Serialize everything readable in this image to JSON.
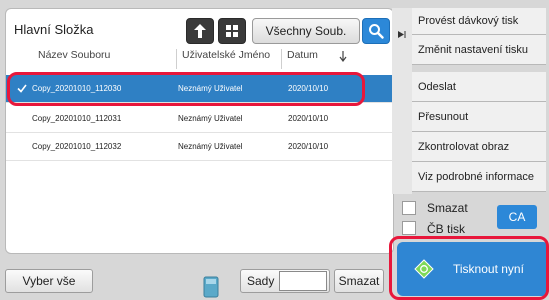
{
  "file_panel": {
    "folder_title": "Hlavní Složka",
    "filter_label": "Všechny Soub.",
    "columns": {
      "name": "Název Souboru",
      "user": "Uživatelské Jméno",
      "date": "Datum"
    },
    "rows": [
      {
        "name": "Copy_20201010_112030",
        "user": "Neznámý Uživatel",
        "date": "2020/10/10",
        "selected": true
      },
      {
        "name": "Copy_20201010_112031",
        "user": "Neznámý Uživatel",
        "date": "2020/10/10",
        "selected": false
      },
      {
        "name": "Copy_20201010_112032",
        "user": "Neznámý Uživatel",
        "date": "2020/10/10",
        "selected": false
      }
    ]
  },
  "bottom_bar": {
    "select_all_label": "Vyber vše",
    "sets_label": "Sady",
    "sets_value": "",
    "delete_label": "Smazat"
  },
  "actions_menu": {
    "items": [
      "Provést dávkový tisk",
      "Změnit nastavení tisku",
      "Odeslat",
      "Přesunout",
      "Zkontrolovat obraz",
      "Viz podrobné informace"
    ]
  },
  "options": {
    "delete_checkbox_label": "Smazat",
    "bw_print_label": "ČB tisk",
    "ca_label": "CA",
    "print_now_label": "Tisknout nyní"
  },
  "colors": {
    "accent_blue": "#2c88d8",
    "highlight_red": "#e8173b",
    "selected_row": "#2f80c4"
  },
  "icons": {
    "up_folder": "arrow-up-icon",
    "grid_view": "grid-icon",
    "search": "search-icon",
    "collapse": "play-icon",
    "print": "diamond-start-icon",
    "thumbnail": "document-thumbnail-icon"
  }
}
